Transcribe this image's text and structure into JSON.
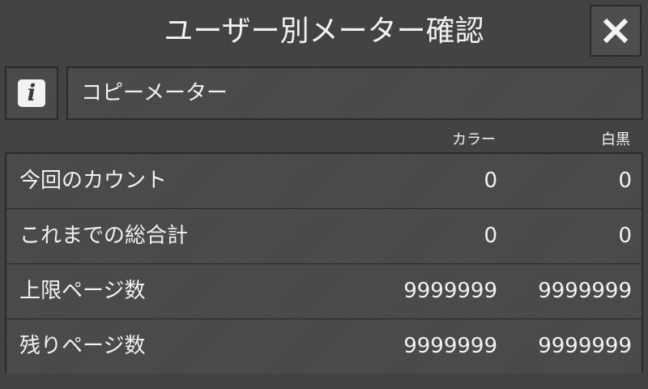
{
  "header": {
    "title": "ユーザー別メーター確認",
    "close_icon": "close-icon"
  },
  "info": {
    "icon": "info-icon",
    "glyph": "i",
    "meter_type": "コピーメーター"
  },
  "columns": {
    "color": "カラー",
    "bw": "白黒"
  },
  "rows": [
    {
      "label": "今回のカウント",
      "color": "0",
      "bw": "0"
    },
    {
      "label": "これまでの総合計",
      "color": "0",
      "bw": "0"
    },
    {
      "label": "上限ページ数",
      "color": "9999999",
      "bw": "9999999"
    },
    {
      "label": "残りページ数",
      "color": "9999999",
      "bw": "9999999"
    }
  ]
}
